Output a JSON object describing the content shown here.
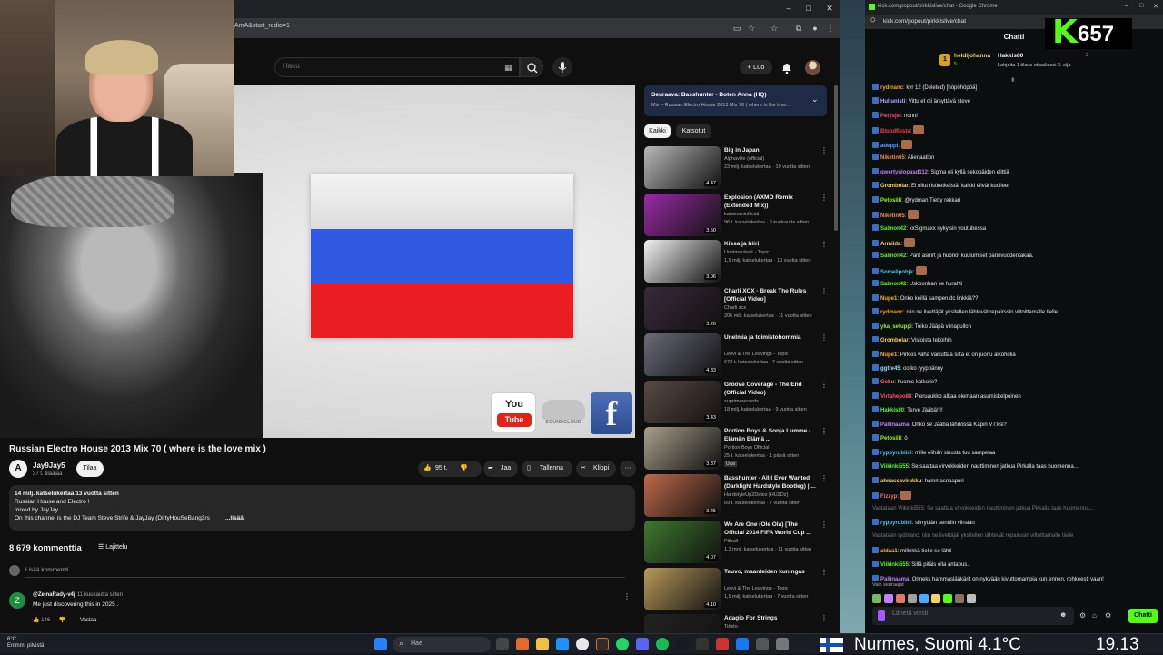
{
  "colors": {
    "youtube_bg": "#0f0f0f",
    "kick_green": "#53fc18",
    "kick_bg": "#0b0e0f",
    "flag_blue": "#2f59e0",
    "flag_red": "#ea1d22"
  },
  "youtube": {
    "address_fragment": "AmA&start_radio=1",
    "search_placeholder": "Haku",
    "create_label": "+ Luo",
    "video": {
      "title": "Russian Electro House 2013 Mix 70 ( where is the love mix )",
      "logos": {
        "youtube_top": "You",
        "youtube_bottom": "Tube",
        "soundcloud": "SOUNDCLOUD",
        "facebook": "f"
      }
    },
    "channel": {
      "avatar_letter": "A",
      "name": "Jay9Jay5",
      "subscribers": "37 t. tilaajaa",
      "subscribe_label": "Tilaa"
    },
    "actions": {
      "likes": "95 t.",
      "share": "Jaa",
      "save": "Tallenna",
      "clip": "Klippi",
      "more": "⋯"
    },
    "description": {
      "stats": "14 milj. katselukertaa  13 vuotta sitten",
      "lines": [
        "Russian House and Electro !",
        "mixed by JayJay.",
        "On this channel is the DJ Team Steve Strife & JayJay (DirtyHouSeBang3rs"
      ],
      "more": "...lisää"
    },
    "comments": {
      "count": "8 679 kommenttia",
      "sort_label": "Lajittelu",
      "add_placeholder": "Lisää kommentti...",
      "first": {
        "avatar_letter": "Z",
        "user": "@ZeinaRady-v4j",
        "time": "11 kuukautta sitten",
        "text": "Me just discovering this in 2025 .",
        "likes": "146",
        "reply": "Vastaa"
      }
    },
    "up_next": {
      "label": "Seuraava: Basshunter - Boten Anna (HQ)",
      "sub": "Mix – Russian Electro House 2013 Mix 70 ( where is the love..."
    },
    "chips": {
      "all": "Kaikki",
      "watched": "Katsotut"
    },
    "recommendations": [
      {
        "title": "Big in Japan",
        "channel": "Alphaville (official)",
        "meta": "23 milj. katselukertaa · 10 vuotta sitten",
        "duration": "4.47",
        "thumb": "#b8b8b8"
      },
      {
        "title": "Explosion (AXMO Remix (Extended Mix))",
        "channel": "kaiwiremiofficial",
        "meta": "96 t. katselukertaa · 6 kuukautta sitten",
        "duration": "3.50",
        "thumb": "#9b2aa8"
      },
      {
        "title": "Kissa ja hiiri",
        "channel": "Unelmavävyt - Topic",
        "meta": "1,9 milj. katselukertaa · 10 vuotta sitten",
        "duration": "3.06",
        "thumb": "#f2f2f2"
      },
      {
        "title": "Charli XCX - Break The Rules [Official Video]",
        "channel": "Charli xcx",
        "meta": "206 milj. katselukertaa · 11 vuotta sitten",
        "duration": "3.26",
        "thumb": "#3a2a3a"
      },
      {
        "title": "Unelmia ja toimistohommia",
        "channel": "Leevi & The Leavings - Topic",
        "meta": "672 t. katselukertaa · 7 vuotta sitten",
        "duration": "4.33",
        "thumb": "#6a6a7a"
      },
      {
        "title": "Groove Coverage - The End (Official Video)",
        "channel": "suprimerecords",
        "meta": "18 milj. katselukertaa · 9 vuotta sitten",
        "duration": "3.43",
        "thumb": "#5a4a44"
      },
      {
        "title": "Portion Boys & Sonja Lumme - Elämän Elämä ...",
        "channel": "Portion Boys Official",
        "meta": "25 t. katselukertaa · 1 päivä sitten",
        "duration": "3.37",
        "thumb": "#a8a08c"
      },
      {
        "title": "Basshunter - All I Ever Wanted (Darklight Hardstyle Bootleg) | ...",
        "channel": "HardstyleUp2Datez [HU2Dz]",
        "meta": "69 t. katselukertaa · 7 vuotta sitten",
        "duration": "3.45",
        "thumb": "#c0684a"
      },
      {
        "title": "We Are One (Ole Ola) [The Official 2014 FIFA World Cup ...",
        "channel": "Pitbull",
        "meta": "1,3 mrd. katselukertaa · 11 vuotta sitten",
        "duration": "4.07",
        "thumb": "#3e7a2e"
      },
      {
        "title": "Teuvo, maanteiden kuningas",
        "channel": "Leevi & The Leavings - Topic",
        "meta": "1,9 milj. katselukertaa · 7 vuotta sitten",
        "duration": "4.10",
        "thumb": "#b89a5a"
      },
      {
        "title": "Adagio For Strings",
        "channel": "Tiësto",
        "meta": "",
        "duration": "",
        "thumb": "#222"
      }
    ],
    "new_badge": "Uusi"
  },
  "kick": {
    "title_bar": "kick.com/popout/pirkkislive/chat - Google Chrome",
    "address": "kick.com/popout/pirkkislive/chat",
    "chat_title": "Chatti",
    "logo_letter": "K",
    "viewer_count": "657",
    "pinned": {
      "rank": "1",
      "user1": "heldijohanna",
      "sub1": "5",
      "user2": "Hakkis80",
      "sub2": "2",
      "gift": "Lahjoita 1 tilaus ottaaksesi 3. sija"
    },
    "messages": [
      {
        "user": "rydmanc",
        "text": "kyr 12 (Deleted) [höpöhöpöä]",
        "color": "#ff9f1c"
      },
      {
        "user": "Hullunisti",
        "text": "Vittu et oli ärsyttävä steve",
        "color": "#c3a6ff"
      },
      {
        "user": "Penisjei",
        "text": "nonni",
        "color": "#ff4d6d"
      },
      {
        "user": "Bloodfiesta",
        "text": "",
        "color": "#ff3b3b"
      },
      {
        "user": "adeppi",
        "text": "",
        "color": "#4da6ff"
      },
      {
        "user": "Niketin65",
        "text": "Alienaation",
        "color": "#ff8c42"
      },
      {
        "user": "qwertyuiopasd112",
        "text": "Sigma oli kyllä sekopäiden elittiä",
        "color": "#c77dff"
      },
      {
        "user": "Grombolar",
        "text": "Ei ollut ristiretkeistä, kaikki elivät kuolleet",
        "color": "#f4d35e"
      },
      {
        "user": "Petosiili",
        "text": "@rydman Tietty rekkari",
        "color": "#9ef01a"
      },
      {
        "user": "Niketin65",
        "text": "",
        "color": "#ff8c42"
      },
      {
        "user": "Salmon42",
        "text": "xxSigmaxx nykyisin youtubessa",
        "color": "#53fc18"
      },
      {
        "user": "Armiida",
        "text": "",
        "color": "#ffd166"
      },
      {
        "user": "Salmon42",
        "text": "Parit asmrt ja huonot kuulumiset parinvuodentakaa.",
        "color": "#53fc18"
      },
      {
        "user": "Somelipohja",
        "text": "",
        "color": "#48cae4"
      },
      {
        "user": "Salmon42",
        "text": "Uskoonhan se hurahti",
        "color": "#53fc18"
      },
      {
        "user": "Nupe1",
        "text": "Onko keillä sampen dc linkkiä??",
        "color": "#ffb703"
      },
      {
        "user": "rydmanc",
        "text": "niin ne livettäjät yksitellen lähtevät repairssin viltoittamalle tielle",
        "color": "#ff9f1c"
      },
      {
        "user": "yka_setuppi",
        "text": "Toiko Jääpä viinapullon",
        "color": "#9ef01a"
      },
      {
        "user": "Grombolar",
        "text": "Visioista tekoihin",
        "color": "#f4d35e"
      },
      {
        "user": "Nupe1",
        "text": "Pirkkis vähä vaikuttaa silta et on juonu alkoholia",
        "color": "#ffb703"
      },
      {
        "user": "ggtre45",
        "text": "ootko ryyppänny",
        "color": "#90e0ef"
      },
      {
        "user": "Gebu",
        "text": "huome katkolle?",
        "color": "#ff6b6b"
      },
      {
        "user": "Virtahepo88",
        "text": "Pieruaukko alkaa olemaan asumiskelpoinen",
        "color": "#ff4d6d"
      },
      {
        "user": "Hakkis80",
        "text": "Terve Jääbä!!!!",
        "color": "#53fc18"
      },
      {
        "user": "Pallinaama",
        "text": "Onko se Jääbä lähdössä Käpin VT:ksi?",
        "color": "#c77dff"
      },
      {
        "user": "Petosiili",
        "text": "ö",
        "color": "#9ef01a"
      },
      {
        "user": "ryppyrubiini",
        "text": "mille elihän sinusta tuu sampelaa",
        "color": "#48cae4"
      },
      {
        "user": "Viikinki555",
        "text": "Se saattaa virvokkeiden nauttiminen jatkua Pirkalla taas huomenna...",
        "color": "#53fc18"
      },
      {
        "user": "ahnassavirukku",
        "text": "hammasnaapuri",
        "color": "#ffd166"
      },
      {
        "user": "Fizzyp",
        "text": "",
        "color": "#ff6b6b"
      },
      {
        "user": "",
        "text": "Vastataan Viikinki555: Se saattaa virvokkeiden nauttiminen jatkua Pirkalla taas huomenna...",
        "color": "#777"
      },
      {
        "user": "ryppyrubiini",
        "text": "siirrytään senttiin viinaan",
        "color": "#48cae4"
      },
      {
        "user": "",
        "text": "Vastataan rydmanc: niin ne livettäjät yksitellen lähtevät repairssin viltoittamalle tielle",
        "color": "#777"
      },
      {
        "user": "aldaa1",
        "text": "millekkä tielle se lähti",
        "color": "#ffb703"
      },
      {
        "user": "Viikinki555",
        "text": "Sillä pitäis olla antabus..",
        "color": "#53fc18"
      },
      {
        "user": "Pallinaama",
        "text": "Onneks hammaslääkärit on nykyään kivuttomampia kun ennen, rohkeesti vaan!",
        "color": "#c77dff"
      }
    ],
    "following_only": "Vain seuraajat",
    "input_placeholder": "Lähetä viesti",
    "send_label": "Chatti"
  },
  "taskbar": {
    "temp": "6°C",
    "weather_text": "Enimm. pilvistä",
    "search_label": "Hae",
    "location": "Nurmes, Suomi   4.1°C",
    "time": "19.13"
  }
}
